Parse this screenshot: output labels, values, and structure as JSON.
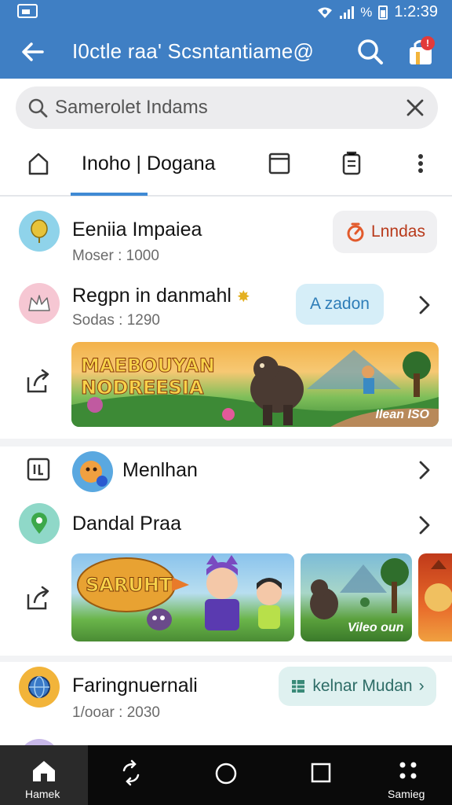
{
  "status_bar": {
    "time": "1:2:39",
    "percent": "%"
  },
  "app_bar": {
    "title": "I0ctle raa' Scsntantiame@",
    "notification_count": "!"
  },
  "search": {
    "value": "Samerolet Indams"
  },
  "tabs": {
    "active_label": "Inoho | Dogana"
  },
  "items": [
    {
      "title": "Eeniia Impaiea",
      "subtitle": "Moser : 1000",
      "action_label": "Lnndas"
    },
    {
      "title": "Regpn in danmahl",
      "subtitle": "Sodas : 1290",
      "action_label": "A zadon",
      "banner_title_line1": "MAEBOUYAN",
      "banner_title_line2": "NODREESIA",
      "banner_caption": "Ilean ISO"
    },
    {
      "title": "Menlhan"
    },
    {
      "title": "Dandal Praa",
      "banner_title": "SARUHT",
      "banner_caption": "Vileo oun"
    },
    {
      "title": "Faringnuernali",
      "subtitle": "1/ooar : 2030",
      "action_label": "kelnar Mudan"
    }
  ],
  "bottom_nav": {
    "home_label": "Hamek",
    "settings_label": "Samieg"
  },
  "colors": {
    "primary": "#3f7fc4",
    "action_pill_red": "#e25a2c",
    "action_pill_blue": "#2e7db8",
    "action_pill_teal": "#3a8a78"
  }
}
